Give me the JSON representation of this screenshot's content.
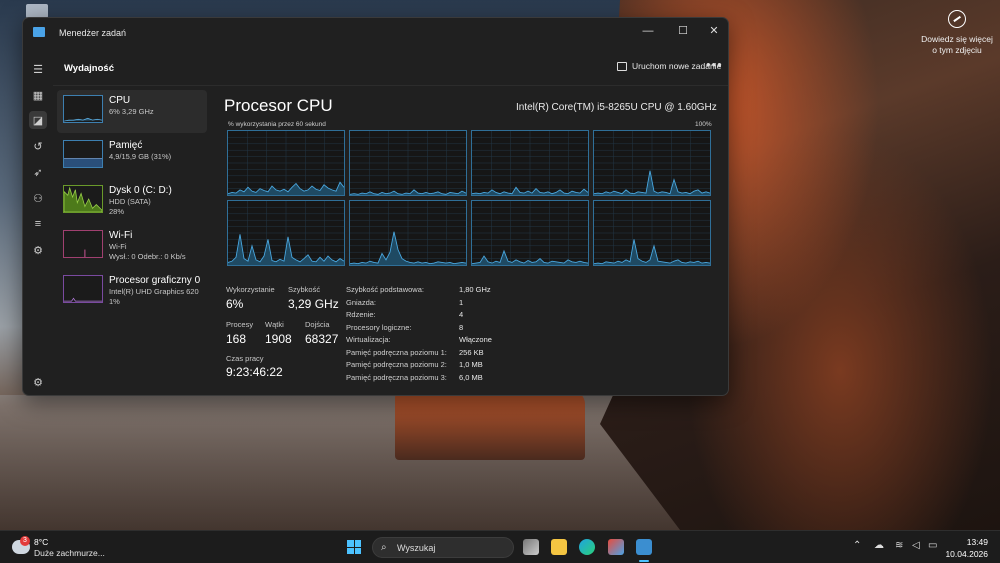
{
  "desktop": {
    "signin_text": "Dowiedz się więcej o tym zdjęciu"
  },
  "window": {
    "title": "Menedżer zadań",
    "minimize": "—",
    "maximize": "☐",
    "close": "✕"
  },
  "header": {
    "title": "Wydajność",
    "run_task": "Uruchom nowe zadanie",
    "more": "•••"
  },
  "sidebar": {
    "icons": [
      "menu-icon",
      "processes-icon",
      "performance-icon",
      "app-history-icon",
      "startup-icon",
      "users-icon",
      "details-icon",
      "services-icon",
      "settings-icon"
    ]
  },
  "perf_list": [
    {
      "name": "CPU",
      "sub1": "6% 3,29 GHz",
      "sub2": "",
      "sub3": ""
    },
    {
      "name": "Pamięć",
      "sub1": "4,9/15,9 GB (31%)",
      "sub2": "",
      "sub3": ""
    },
    {
      "name": "Dysk 0 (C: D:)",
      "sub1": "HDD (SATA)",
      "sub2": "28%",
      "sub3": ""
    },
    {
      "name": "Wi-Fi",
      "sub1": "Wi-Fi",
      "sub2": "Wysł.: 0 Odebr.: 0 Kb/s",
      "sub3": ""
    },
    {
      "name": "Procesor graficzny 0",
      "sub1": "Intel(R) UHD Graphics 620",
      "sub2": "1%",
      "sub3": ""
    }
  ],
  "cpu": {
    "title": "Procesor CPU",
    "model": "Intel(R) Core(TM) i5-8265U CPU @ 1.60GHz",
    "graph_label": "% wykorzystania przez 60 sekund",
    "graph_max": "100%",
    "stats": {
      "usage_label": "Wykorzystanie",
      "usage": "6%",
      "speed_label": "Szybkość",
      "speed": "3,29 GHz",
      "processes_label": "Procesy",
      "processes": "168",
      "threads_label": "Wątki",
      "threads": "1908",
      "handles_label": "Dojścia",
      "handles": "68327",
      "uptime_label": "Czas pracy",
      "uptime": "9:23:46:22"
    },
    "specs": [
      {
        "label": "Szybkość podstawowa:",
        "value": "1,80 GHz"
      },
      {
        "label": "Gniazda:",
        "value": "1"
      },
      {
        "label": "Rdzenie:",
        "value": "4"
      },
      {
        "label": "Procesory logiczne:",
        "value": "8"
      },
      {
        "label": "Wirtualizacja:",
        "value": "Włączone"
      },
      {
        "label": "Pamięć podręczna poziomu 1:",
        "value": "256 KB"
      },
      {
        "label": "Pamięć podręczna poziomu 2:",
        "value": "1,0 MB"
      },
      {
        "label": "Pamięć podręczna poziomu 3:",
        "value": "6,0 MB"
      }
    ],
    "core_usage": [
      [
        2,
        4,
        3,
        8,
        5,
        12,
        6,
        4,
        10,
        7,
        5,
        14,
        8,
        6,
        9,
        5,
        12,
        18,
        10,
        6,
        8,
        14,
        9,
        7,
        16,
        11,
        8,
        6,
        20,
        12
      ],
      [
        1,
        2,
        1,
        3,
        2,
        5,
        2,
        1,
        4,
        2,
        3,
        6,
        2,
        1,
        3,
        2,
        8,
        3,
        2,
        4,
        2,
        3,
        5,
        2,
        1,
        4,
        3,
        2,
        6,
        3
      ],
      [
        2,
        3,
        2,
        4,
        3,
        8,
        4,
        2,
        5,
        3,
        2,
        12,
        4,
        3,
        6,
        3,
        10,
        4,
        3,
        5,
        2,
        4,
        8,
        3,
        2,
        6,
        4,
        3,
        9,
        4
      ],
      [
        2,
        3,
        2,
        5,
        3,
        6,
        4,
        2,
        8,
        3,
        2,
        5,
        4,
        3,
        38,
        6,
        3,
        5,
        4,
        2,
        24,
        5,
        3,
        4,
        2,
        6,
        8,
        3,
        5,
        3
      ],
      [
        4,
        6,
        12,
        48,
        10,
        6,
        30,
        8,
        5,
        14,
        40,
        7,
        5,
        9,
        6,
        44,
        12,
        8,
        5,
        10,
        16,
        6,
        5,
        12,
        6,
        14,
        8,
        5,
        10,
        6
      ],
      [
        2,
        3,
        2,
        4,
        3,
        6,
        4,
        3,
        18,
        8,
        20,
        52,
        24,
        10,
        6,
        4,
        3,
        5,
        3,
        4,
        2,
        3,
        5,
        4,
        3,
        4,
        2,
        3,
        4,
        3
      ],
      [
        2,
        3,
        4,
        14,
        5,
        3,
        6,
        4,
        22,
        6,
        4,
        8,
        5,
        3,
        7,
        4,
        5,
        10,
        4,
        3,
        6,
        5,
        4,
        3,
        8,
        5,
        4,
        6,
        4,
        3
      ],
      [
        2,
        3,
        2,
        5,
        4,
        3,
        6,
        4,
        8,
        5,
        40,
        10,
        6,
        4,
        8,
        30,
        6,
        5,
        4,
        3,
        6,
        8,
        4,
        3,
        5,
        4,
        6,
        3,
        4,
        3
      ]
    ]
  },
  "taskbar": {
    "temp": "8°C",
    "condition": "Duże zachmurze...",
    "weather_badge": "3",
    "search": "Wyszukaj",
    "time": "13:49",
    "date": "10.04.2026"
  }
}
